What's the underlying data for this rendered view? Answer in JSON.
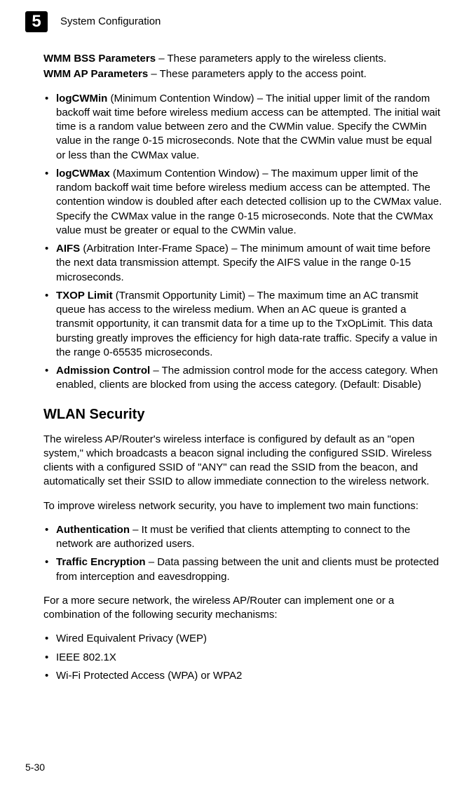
{
  "header": {
    "chapterNumber": "5",
    "chapterTitle": "System Configuration"
  },
  "intro": {
    "bssLabel": "WMM BSS Parameters",
    "bssDesc": " – These parameters apply to the wireless clients.",
    "apLabel": "WMM AP Parameters",
    "apDesc": " – These parameters apply to the access point."
  },
  "paramList": [
    {
      "term": "logCWMin",
      "desc": " (Minimum Contention Window) – The initial upper limit of the random backoff wait time before wireless medium access can be attempted. The initial wait time is a random value between zero and the CWMin value. Specify the CWMin value in the range 0-15 microseconds. Note that the CWMin value must be equal or less than the CWMax value."
    },
    {
      "term": "logCWMax",
      "desc": " (Maximum Contention Window) – The maximum upper limit of the random backoff wait time before wireless medium access can be attempted. The contention window is doubled after each detected collision up to the CWMax value. Specify the CWMax value in the range 0-15 microseconds. Note that the CWMax value must be greater or equal to the CWMin value."
    },
    {
      "term": "AIFS",
      "desc": " (Arbitration Inter-Frame Space) – The minimum amount of wait time before the next data transmission attempt. Specify the AIFS value in the range 0-15 microseconds."
    },
    {
      "term": "TXOP Limit",
      "desc": " (Transmit Opportunity Limit) – The maximum time an AC transmit queue has access to the wireless medium. When an AC queue is granted a transmit opportunity, it can transmit data for a time up to the TxOpLimit. This data bursting greatly improves the efficiency for high data-rate traffic. Specify a value in the range 0-65535 microseconds."
    },
    {
      "term": "Admission Control",
      "desc": " – The admission control mode for the access category. When enabled, clients are blocked from using the access category. (Default: Disable)"
    }
  ],
  "section": {
    "heading": "WLAN Security",
    "para1": "The wireless AP/Router's wireless interface is configured by default as an \"open system,\" which broadcasts a beacon signal including the configured SSID. Wireless clients with a configured SSID of \"ANY\" can read the SSID from the beacon, and automatically set their SSID to allow immediate connection to the wireless network.",
    "para2": "To improve wireless network security, you have to implement two main functions:"
  },
  "funcList": [
    {
      "term": "Authentication",
      "desc": " – It must be verified that clients attempting to connect to the network are authorized users."
    },
    {
      "term": "Traffic Encryption",
      "desc": " – Data passing between the unit and clients must be protected from interception and eavesdropping."
    }
  ],
  "afterFunc": "For a more secure network, the wireless AP/Router can implement one or a combination of the following security mechanisms:",
  "mechList": [
    "Wired Equivalent Privacy (WEP)",
    "IEEE 802.1X",
    "Wi-Fi Protected Access (WPA) or WPA2"
  ],
  "pageNumber": "5-30"
}
